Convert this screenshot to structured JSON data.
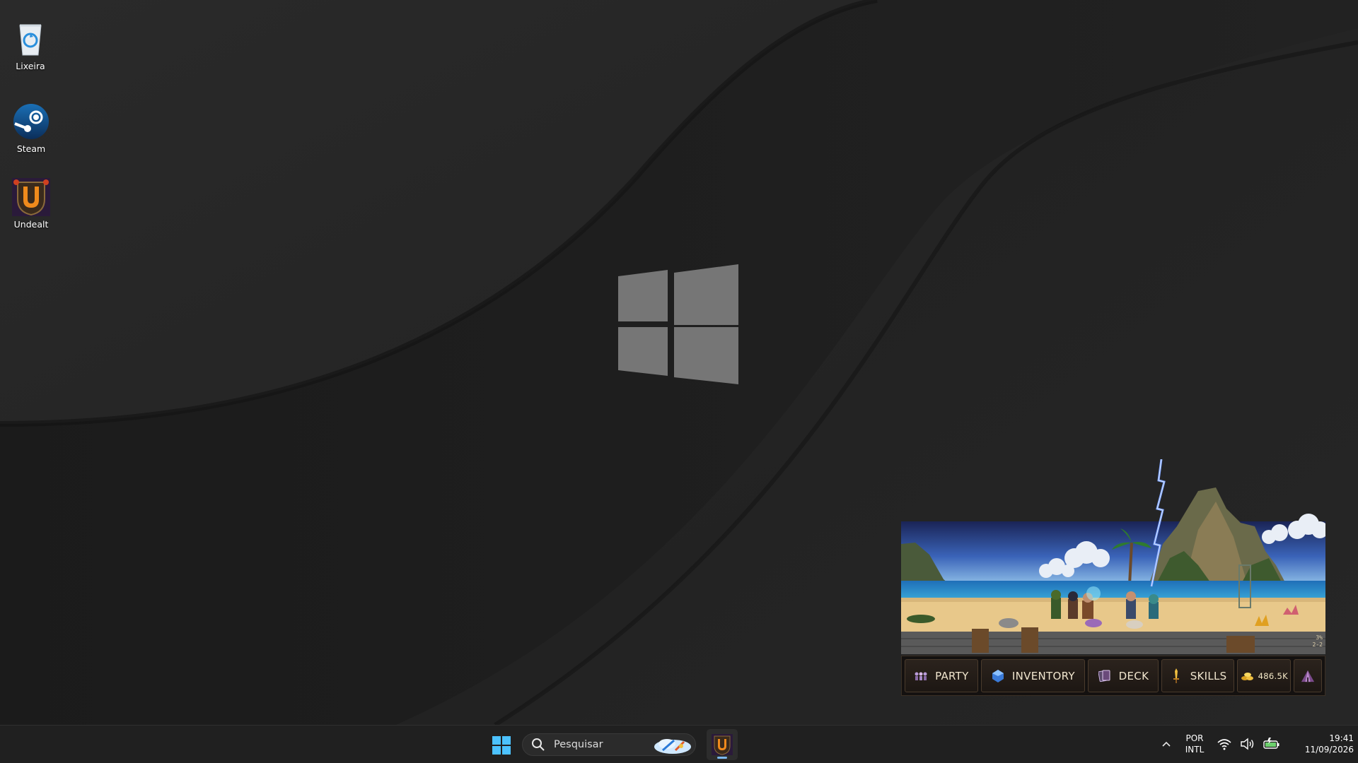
{
  "desktop": {
    "icons": [
      {
        "label": "Lixeira",
        "icon": "recycle-bin-icon"
      },
      {
        "label": "Steam",
        "icon": "steam-icon"
      },
      {
        "label": "Undealt",
        "icon": "undealt-game-icon"
      }
    ]
  },
  "game_widget": {
    "buttons": {
      "party": "PARTY",
      "inventory": "INVENTORY",
      "deck": "DECK",
      "skills": "SKILLS"
    },
    "gold": "486.5K",
    "corner_top": "3%",
    "corner_bottom": "2-2"
  },
  "taskbar": {
    "search_placeholder": "Pesquisar",
    "language_top": "POR",
    "language_bottom": "INTL",
    "time": "19:41",
    "date": "11/09/2026"
  },
  "colors": {
    "taskbar_bg": "#202020",
    "accent_blue": "#4cc2ff",
    "wallpaper_dark": "#151515"
  }
}
